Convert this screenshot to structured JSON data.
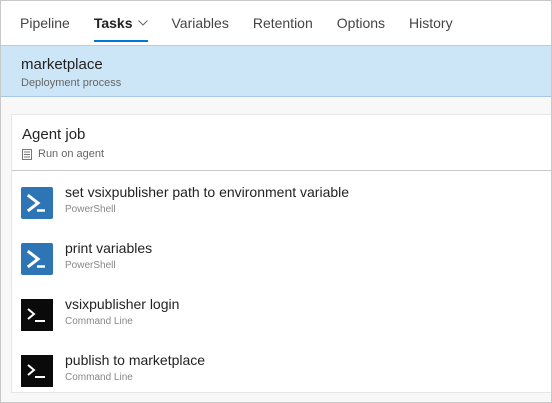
{
  "tabs": [
    {
      "label": "Pipeline"
    },
    {
      "label": "Tasks"
    },
    {
      "label": "Variables"
    },
    {
      "label": "Retention"
    },
    {
      "label": "Options"
    },
    {
      "label": "History"
    }
  ],
  "active_tab": "Tasks",
  "stage": {
    "title": "marketplace",
    "subtitle": "Deployment process"
  },
  "job": {
    "title": "Agent job",
    "subtitle": "Run on agent",
    "icon": "server-icon"
  },
  "tasks": [
    {
      "name": "set vsixpublisher path to environment variable",
      "type": "PowerShell",
      "icon": "powershell-icon"
    },
    {
      "name": "print variables",
      "type": "PowerShell",
      "icon": "powershell-icon"
    },
    {
      "name": "vsixpublisher login",
      "type": "Command Line",
      "icon": "command-line-icon"
    },
    {
      "name": "publish to marketplace",
      "type": "Command Line",
      "icon": "command-line-icon"
    }
  ],
  "colors": {
    "accent": "#0078d4",
    "selected_bg": "#cde6f7",
    "powershell": "#2e75b6",
    "command_line": "#0a0a0a"
  }
}
